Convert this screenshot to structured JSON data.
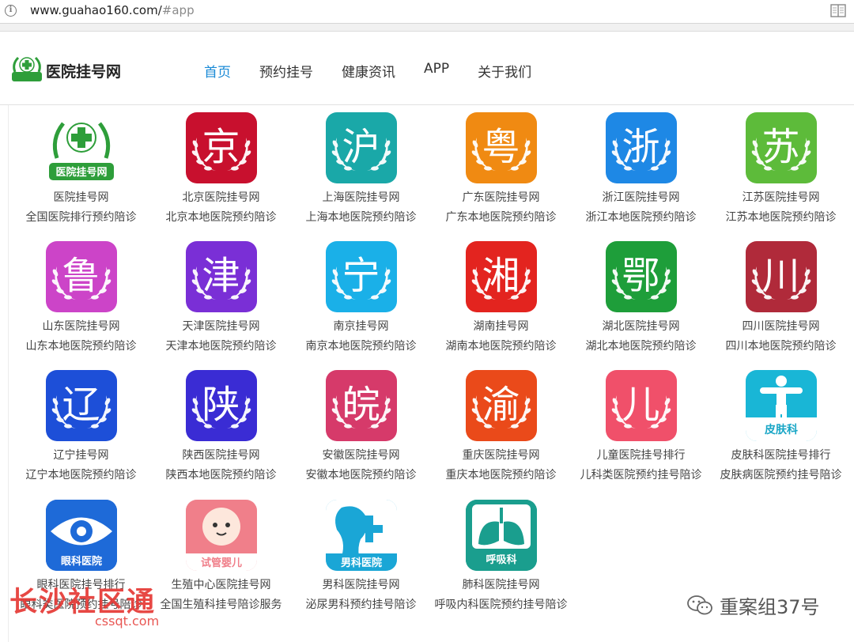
{
  "browser": {
    "url_main": "www.guahao160.com/",
    "url_fragment": "#app"
  },
  "site": {
    "name": "医院挂号网"
  },
  "nav": [
    {
      "label": "首页",
      "active": true
    },
    {
      "label": "预约挂号",
      "active": false
    },
    {
      "label": "健康资讯",
      "active": false
    },
    {
      "label": "APP",
      "active": false
    },
    {
      "label": "关于我们",
      "active": false
    }
  ],
  "apps": [
    {
      "name": "医院挂号网",
      "desc": "全国医院排行预约陪诊",
      "glyph": "",
      "icon_label": "医院挂号网",
      "color": "#ffffff",
      "icon": "hospital-cross-icon"
    },
    {
      "name": "北京医院挂号网",
      "desc": "北京本地医院预约陪诊",
      "glyph": "京",
      "color": "#c8102e",
      "icon": "jing-icon"
    },
    {
      "name": "上海医院挂号网",
      "desc": "上海本地医院预约陪诊",
      "glyph": "沪",
      "color": "#1aa8a8",
      "icon": "hu-icon"
    },
    {
      "name": "广东医院挂号网",
      "desc": "广东本地医院预约陪诊",
      "glyph": "粤",
      "color": "#f08a12",
      "icon": "yue-icon"
    },
    {
      "name": "浙江医院挂号网",
      "desc": "浙江本地医院预约陪诊",
      "glyph": "浙",
      "color": "#1e88e5",
      "icon": "zhe-icon"
    },
    {
      "name": "江苏医院挂号网",
      "desc": "江苏本地医院预约陪诊",
      "glyph": "苏",
      "color": "#5dbb3a",
      "icon": "su-icon"
    },
    {
      "name": "山东医院挂号网",
      "desc": "山东本地医院预约陪诊",
      "glyph": "鲁",
      "color": "#cc44c8",
      "icon": "lu-icon"
    },
    {
      "name": "天津医院挂号网",
      "desc": "天津本地医院预约陪诊",
      "glyph": "津",
      "color": "#7a2fd6",
      "icon": "jin-icon"
    },
    {
      "name": "南京挂号网",
      "desc": "南京本地医院预约陪诊",
      "glyph": "宁",
      "color": "#1ab0e8",
      "icon": "ning-icon"
    },
    {
      "name": "湖南挂号网",
      "desc": "湖南本地医院预约陪诊",
      "glyph": "湘",
      "color": "#e3241f",
      "icon": "xiang-icon"
    },
    {
      "name": "湖北医院挂号网",
      "desc": "湖北本地医院预约陪诊",
      "glyph": "鄂",
      "color": "#1e9e3a",
      "icon": "e-icon"
    },
    {
      "name": "四川医院挂号网",
      "desc": "四川本地医院预约陪诊",
      "glyph": "川",
      "color": "#b02a3a",
      "icon": "chuan-icon"
    },
    {
      "name": "辽宁挂号网",
      "desc": "辽宁本地医院预约陪诊",
      "glyph": "辽",
      "color": "#1d4fd8",
      "icon": "liao-icon"
    },
    {
      "name": "陕西医院挂号网",
      "desc": "陕西本地医院预约陪诊",
      "glyph": "陕",
      "color": "#3a2cd4",
      "icon": "shaan-icon"
    },
    {
      "name": "安徽医院挂号网",
      "desc": "安徽本地医院预约陪诊",
      "glyph": "皖",
      "color": "#d63a6a",
      "icon": "wan-icon"
    },
    {
      "name": "重庆医院挂号网",
      "desc": "重庆本地医院预约陪诊",
      "glyph": "渝",
      "color": "#ea4a1a",
      "icon": "yu-icon"
    },
    {
      "name": "儿童医院挂号排行",
      "desc": "儿科类医院预约挂号陪诊",
      "glyph": "儿",
      "color": "#f0506a",
      "icon": "er-icon"
    },
    {
      "name": "皮肤科医院挂号排行",
      "desc": "皮肤病医院预约挂号陪诊",
      "glyph": "",
      "icon_label": "皮肤科",
      "color": "#19b6d6",
      "icon": "dermatology-icon"
    },
    {
      "name": "眼科医院挂号排行",
      "desc": "眼科类医院预约挂号陪诊",
      "glyph": "",
      "icon_label": "眼科医院",
      "color": "#1e6ad8",
      "icon": "eye-icon"
    },
    {
      "name": "生殖中心医院挂号网",
      "desc": "全国生殖科挂号陪诊服务",
      "glyph": "",
      "icon_label": "试管婴儿",
      "color": "#f07f8a",
      "icon": "baby-icon"
    },
    {
      "name": "男科医院挂号网",
      "desc": "泌尿男科预约挂号陪诊",
      "glyph": "",
      "icon_label": "男科医院",
      "color": "#1aa6d6",
      "icon": "andrology-icon"
    },
    {
      "name": "肺科医院挂号网",
      "desc": "呼吸内科医院预约挂号陪诊",
      "glyph": "",
      "icon_label": "呼吸科",
      "color": "#1a9e8e",
      "icon": "lungs-icon"
    }
  ],
  "watermark": {
    "left": "长沙社区通",
    "left_sub": "cssqt.com",
    "right": "重案组37号"
  }
}
